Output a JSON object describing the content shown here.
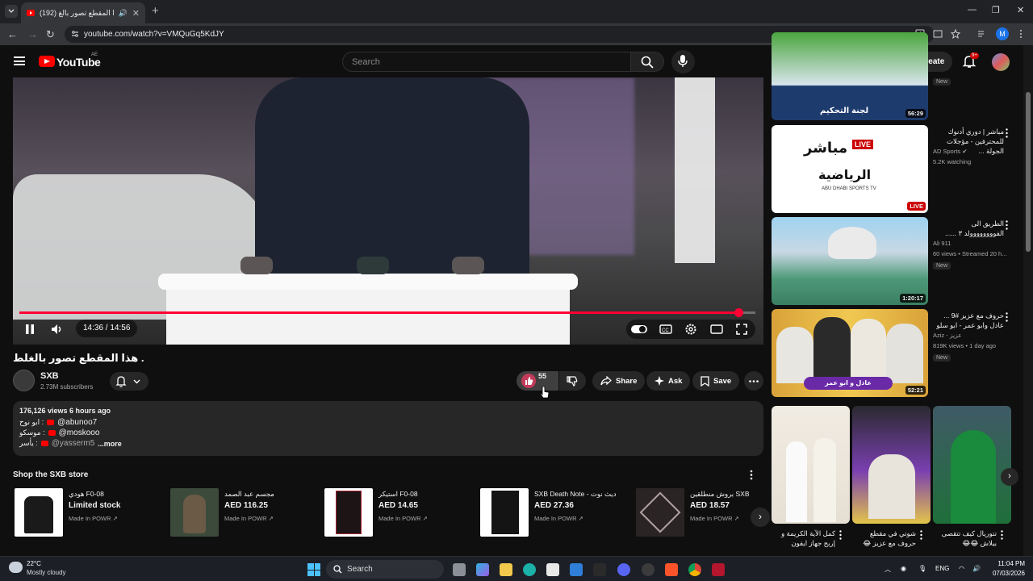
{
  "browser": {
    "tab_title": "(192) هذا المقطع تصور بالغ...",
    "url": "youtube.com/watch?v=VMQuGq5KdJY",
    "profile_letter": "M"
  },
  "youtube": {
    "logo_text": "YouTube",
    "country_code": "AE",
    "search_placeholder": "Search",
    "create_label": "Create",
    "notifications_badge": "9+"
  },
  "player": {
    "time": "14:36 / 14:56",
    "progress_fraction": 0.977
  },
  "video": {
    "title": "هذا المقطع تصور بالغلط .",
    "channel": "SXB",
    "subscribers": "2.73M subscribers",
    "likes": "55",
    "share_label": "Share",
    "ask_label": "Ask",
    "save_label": "Save"
  },
  "description": {
    "meta": "176,126 views  6 hours ago",
    "lines": [
      {
        "label": "ابو نوح :",
        "handle": "@abunoo7"
      },
      {
        "label": "موسكو :",
        "handle": "@moskooo"
      },
      {
        "label": "يأسر :",
        "handle": "@yasserm5"
      }
    ],
    "more": "...more"
  },
  "shop": {
    "title": "Shop the SXB store",
    "products": [
      {
        "title": "هودي F0-08",
        "price": "Limited stock",
        "seller": "Made In POWR"
      },
      {
        "title": "مجسم عبد الصمد",
        "price": "AED 116.25",
        "seller": "Made In POWR"
      },
      {
        "title": "استيكر F0-08",
        "price": "AED 14.65",
        "seller": "Made In POWR"
      },
      {
        "title": "SXB Death Note - ديث نوت",
        "price": "AED 27.36",
        "seller": "Made In POWR"
      },
      {
        "title": "بروش منطلقين SXB",
        "price": "AED 18.57",
        "seller": "Made In POWR"
      }
    ]
  },
  "recommendations": [
    {
      "title": "",
      "channel": "",
      "views": "",
      "badge": "New",
      "duration": "56:29",
      "live": ""
    },
    {
      "title": "مباشر | دوري أدنوك للمحترفين - مؤجلات الجولة ...",
      "channel": "AD Sports",
      "views": "5.2K watching",
      "badge": "",
      "duration": "",
      "live": "LIVE"
    },
    {
      "title": "الطريق الى الفوووووووولد ٣ ......",
      "channel": "Ali 911",
      "views": "60 views • Streamed 20 h...",
      "badge": "New",
      "duration": "1:20:17",
      "live": ""
    },
    {
      "title": "حروف مع عزيز #9 ... عادل وابو عمر - ابو سلو",
      "channel": "Aziz - عزيز",
      "views": "819K views • 1 day ago",
      "badge": "New",
      "duration": "52:21",
      "live": ""
    }
  ],
  "rec_thumb_text": {
    "t1": "لجنة التحكيم",
    "t2_top": "مباشر",
    "t2_live": "LIVE",
    "t2_main": "الرياضية",
    "t2_sub": "ABU DHABI SPORTS TV",
    "t4": "عادل و ابو عمر"
  },
  "shorts": [
    {
      "title": "كمل الآية الكريمة و إربح جهاز ايفون"
    },
    {
      "title": "شوتي في مقطع حروف مع عزيز 😂"
    },
    {
      "title": "تتوريال كيف تتقصى ببلاش 😂😂"
    }
  ],
  "taskbar": {
    "temp": "22°C",
    "weather": "Mostly cloudy",
    "search": "Search",
    "lang": "ENG",
    "time": "11:04 PM",
    "date": "07/03/2026"
  },
  "colors": {
    "accent": "#ff0033",
    "background": "#0f0f0f",
    "live": "#cc0000"
  }
}
